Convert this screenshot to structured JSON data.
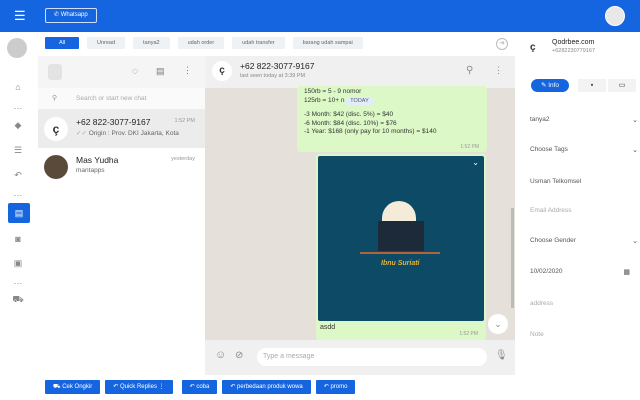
{
  "topbar": {
    "whatsapp_label": "Whatsapp"
  },
  "filters": {
    "chips": [
      "All",
      "Unread",
      "tanya2",
      "udah order",
      "udah transfer",
      "barang udah sampai"
    ]
  },
  "chat_list": {
    "search_placeholder": "Search or start new chat",
    "items": [
      {
        "name": "+62 822-3077-9167",
        "time": "1:52 PM",
        "preview": "Origin : Prov. DKI Jakarta, Kota"
      },
      {
        "name": "Mas Yudha",
        "time": "yesterday",
        "preview": "mantapps"
      }
    ]
  },
  "chat": {
    "contact_name": "+62 822-3077-9167",
    "last_seen": "last seen today at 3:39 PM",
    "messages": [
      {
        "lines": [
          "150rb = 5 - 9 nomor",
          "125rb = 10+ n"
        ],
        "date_badge": "TODAY",
        "lines2": [
          "-3 Month: $42 (disc. 5%) = $40",
          "-6 Month: $84 (disc. 10%) = $76",
          "-1 Year: $168 (only pay for 10 months) = $140"
        ],
        "time": "1:52 PM"
      },
      {
        "image_title": "Ibnu Suriati",
        "caption": "asdd",
        "time": "1:52 PM"
      }
    ],
    "input_placeholder": "Type a message"
  },
  "profile": {
    "name": "Qodrbee.com",
    "phone": "+6282230779167",
    "tabs": {
      "info": "Info"
    },
    "label_select": "tanya2",
    "tags_select": "Choose Tags",
    "name_field": "Usman Telkomsel",
    "email_placeholder": "Email Address",
    "gender_select": "Choose Gender",
    "date": "10/02/2020",
    "address_placeholder": "address",
    "note_placeholder": "Note"
  },
  "quick_buttons": [
    "Cek Ongkir",
    "Quick Replies",
    "coba",
    "perbedaan produk wowa",
    "promo"
  ],
  "colors": {
    "primary": "#1565e0",
    "bubble": "#dcf8c6",
    "chat_bg": "#e5e0d9"
  }
}
